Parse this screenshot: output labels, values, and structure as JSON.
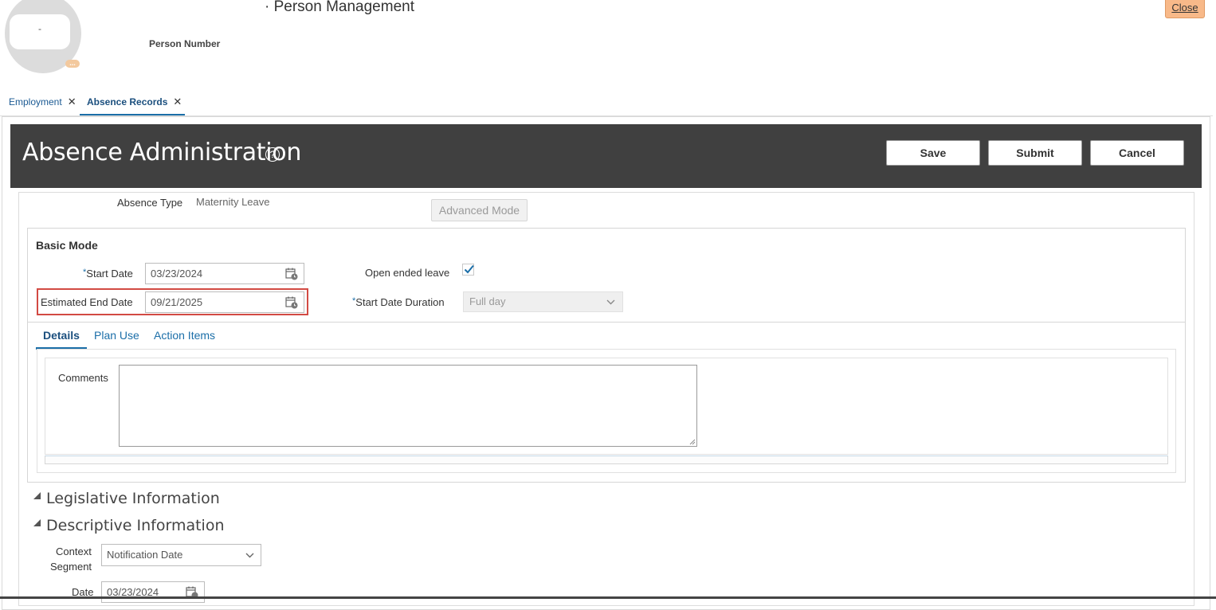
{
  "header": {
    "avatar_initial": "-",
    "avatar_badge": "...",
    "page_title": "· Person Management",
    "person_number_label": "Person Number",
    "close_label": "Close"
  },
  "tabs": [
    {
      "label": "Employment",
      "active": false
    },
    {
      "label": "Absence Records",
      "active": true
    }
  ],
  "title_bar": {
    "title": "Absence Administration",
    "help_glyph": "?",
    "save_label": "Save",
    "submit_label": "Submit",
    "cancel_label": "Cancel"
  },
  "absence": {
    "type_label": "Absence Type",
    "type_value": "Maternity Leave",
    "advanced_mode_label": "Advanced Mode"
  },
  "basic_mode": {
    "title": "Basic Mode",
    "start_date_label": "Start Date",
    "start_date_value": "03/23/2024",
    "end_date_label": "Estimated End Date",
    "end_date_value": "09/21/2025",
    "open_ended_label": "Open ended leave",
    "open_ended_checked": true,
    "start_duration_label": "Start Date Duration",
    "start_duration_value": "Full day",
    "required_marker": "*"
  },
  "subtabs": [
    {
      "label": "Details",
      "active": true
    },
    {
      "label": "Plan Use",
      "active": false
    },
    {
      "label": "Action Items",
      "active": false
    }
  ],
  "details": {
    "comments_label": "Comments",
    "comments_value": ""
  },
  "sections": {
    "legislative": "Legislative Information",
    "descriptive": "Descriptive Information"
  },
  "descriptive": {
    "context_label_line1": "Context",
    "context_label_line2": "Segment",
    "context_value": "Notification Date",
    "date_label": "Date",
    "date_value": "03/23/2024"
  },
  "colors": {
    "accent": "#1b6ea8",
    "title_bar": "#404040",
    "close_button": "#f8b989",
    "highlight": "#d24a43"
  }
}
